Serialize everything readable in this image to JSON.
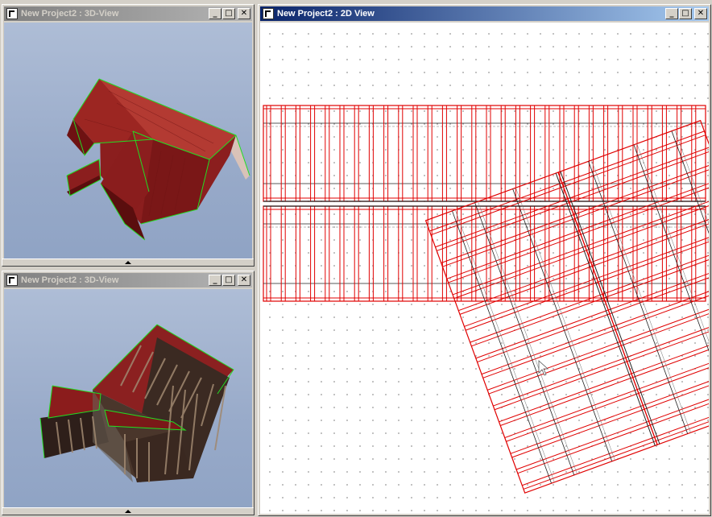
{
  "windows": {
    "view3d_top": {
      "title": "New Project2 : 3D-View"
    },
    "view3d_bottom": {
      "title": "New Project2 : 3D-View"
    },
    "view2d": {
      "title": "New Project2 : 2D View"
    }
  },
  "buttons": {
    "minimize": "_",
    "maximize": "□",
    "close": "✕"
  },
  "icons": {
    "window_icon": "app-window-icon",
    "splitter": "splitter-up-arrow-icon",
    "cursor": "mouse-cursor-icon"
  },
  "colors": {
    "roof_red": "#a52a2a",
    "frame_red": "#e00000",
    "edge_green": "#22dd22",
    "sky": "#9bacca",
    "active_title": "#0a246a",
    "inactive_title": "#808080"
  }
}
